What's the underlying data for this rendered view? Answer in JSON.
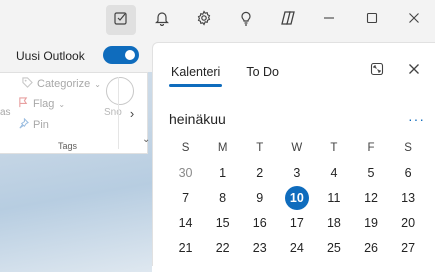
{
  "background": {
    "toggle_label": "Uusi Outlook",
    "toggle_on": true,
    "ribbon": {
      "categorize": "Categorize",
      "flag": "Flag",
      "pin": "Pin",
      "side_fragment": "as",
      "snooze_fragment": "Sno",
      "group_label": "Tags"
    }
  },
  "topbar": {
    "icons": [
      "tasks-icon",
      "bell-icon",
      "gear-icon",
      "lightbulb-icon",
      "copilot-icon",
      "minimize-icon",
      "maximize-icon",
      "close-icon"
    ]
  },
  "pane": {
    "tabs": [
      {
        "label": "Kalenteri",
        "active": true
      },
      {
        "label": "To Do",
        "active": false
      }
    ],
    "month_title": "heinäkuu",
    "more_label": "···",
    "weekdays": [
      "S",
      "M",
      "T",
      "W",
      "T",
      "F",
      "S"
    ],
    "weeks": [
      [
        "30",
        "1",
        "2",
        "3",
        "4",
        "5",
        "6"
      ],
      [
        "7",
        "8",
        "9",
        "10",
        "11",
        "12",
        "13"
      ],
      [
        "14",
        "15",
        "16",
        "17",
        "18",
        "19",
        "20"
      ],
      [
        "21",
        "22",
        "23",
        "24",
        "25",
        "26",
        "27"
      ],
      [
        "28",
        "29",
        "30",
        "31",
        "1",
        "2",
        "3"
      ]
    ],
    "today": "10",
    "accent_color": "#0f6cbd"
  }
}
